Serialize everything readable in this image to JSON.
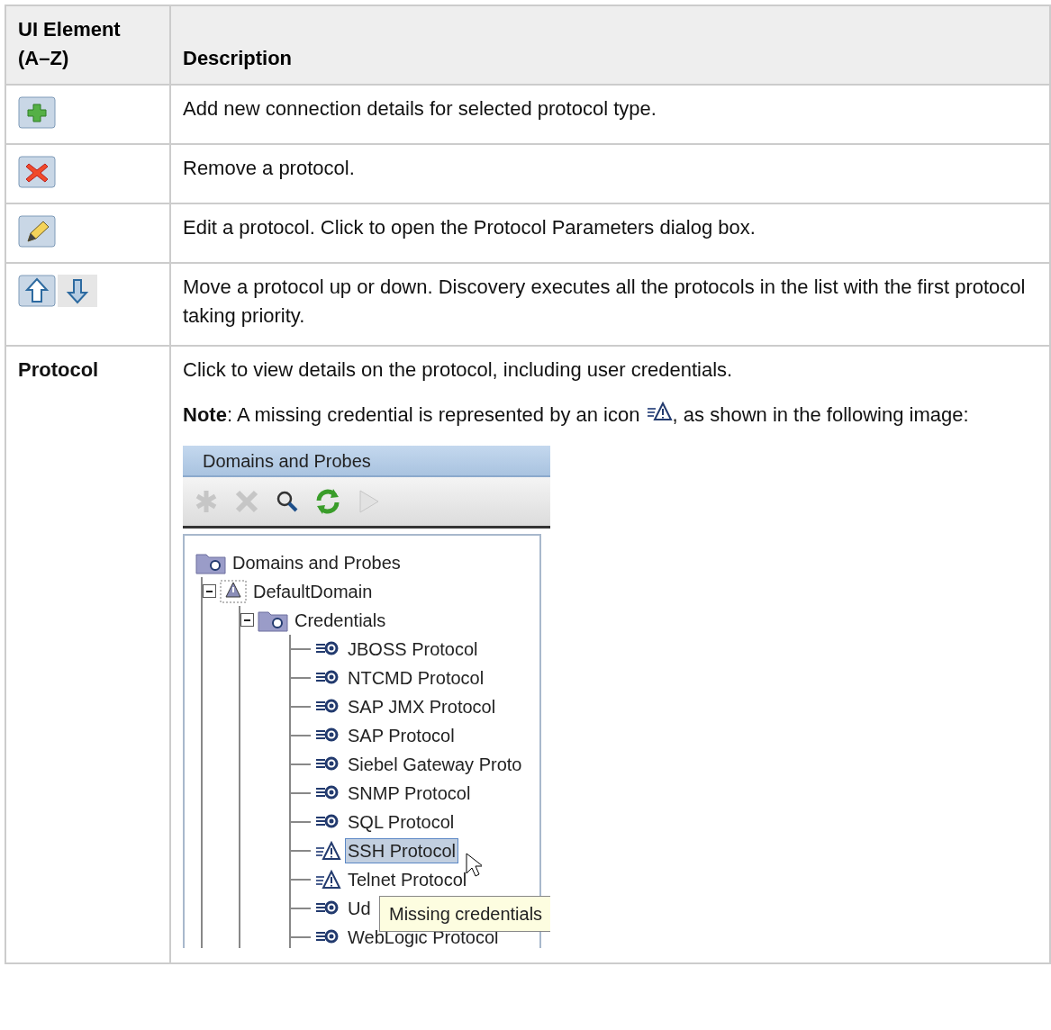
{
  "table": {
    "columns": [
      "UI Element (A–Z)",
      "Description"
    ],
    "rows": [
      {
        "element": {
          "kind": "add"
        },
        "paragraphs": [
          "Add new connection details for selected protocol type."
        ]
      },
      {
        "element": {
          "kind": "remove"
        },
        "paragraphs": [
          "Remove a protocol."
        ]
      },
      {
        "element": {
          "kind": "edit"
        },
        "paragraphs": [
          "Edit a protocol. Click to open the Protocol Parameters dialog box."
        ]
      },
      {
        "element": {
          "kind": "move"
        },
        "paragraphs": [
          "Move a protocol up or down. Discovery executes all the protocols in the list with the first protocol taking priority."
        ]
      },
      {
        "element": {
          "kind": "text",
          "label": "Protocol"
        },
        "paragraphs": [
          "Click to view details on the protocol, including user credentials."
        ],
        "note": {
          "before": "**Note**: A missing credential is represented by an icon",
          "after": ", as shown in the following image:"
        },
        "screenshot": {
          "title": "Domains and Probes",
          "toolbar": [
            {
              "kind": "asterisk",
              "disabled": true
            },
            {
              "kind": "delete",
              "disabled": true
            },
            {
              "kind": "search",
              "disabled": false
            },
            {
              "kind": "refresh",
              "disabled": false
            },
            {
              "kind": "play",
              "disabled": true
            }
          ],
          "tree": [
            {
              "label": "Domains and Probes",
              "kind": "root",
              "children": [
                {
                  "label": "DefaultDomain",
                  "kind": "domain",
                  "expanded": true,
                  "children": [
                    {
                      "label": "Credentials",
                      "kind": "folder",
                      "expanded": true,
                      "children": [
                        {
                          "label": "JBOSS Protocol",
                          "kind": "protocol",
                          "selected": false
                        },
                        {
                          "label": "NTCMD Protocol",
                          "kind": "protocol",
                          "selected": false
                        },
                        {
                          "label": "SAP JMX Protocol",
                          "kind": "protocol",
                          "selected": false
                        },
                        {
                          "label": "SAP Protocol",
                          "kind": "protocol",
                          "selected": false
                        },
                        {
                          "label": "Siebel Gateway Proto",
                          "kind": "protocol",
                          "selected": false
                        },
                        {
                          "label": "SNMP Protocol",
                          "kind": "protocol",
                          "selected": false
                        },
                        {
                          "label": "SQL Protocol",
                          "kind": "protocol",
                          "selected": false
                        },
                        {
                          "label": "SSH Protocol",
                          "kind": "missing",
                          "selected": true
                        },
                        {
                          "label": "Telnet Protocol",
                          "kind": "missing",
                          "selected": false
                        },
                        {
                          "label": "Ud",
                          "kind": "protocol",
                          "selected": false
                        },
                        {
                          "label": "WebLogic Protocol",
                          "kind": "protocol",
                          "selected": false
                        }
                      ]
                    }
                  ]
                }
              ]
            }
          ],
          "tooltip": "Missing credentials"
        }
      }
    ]
  }
}
